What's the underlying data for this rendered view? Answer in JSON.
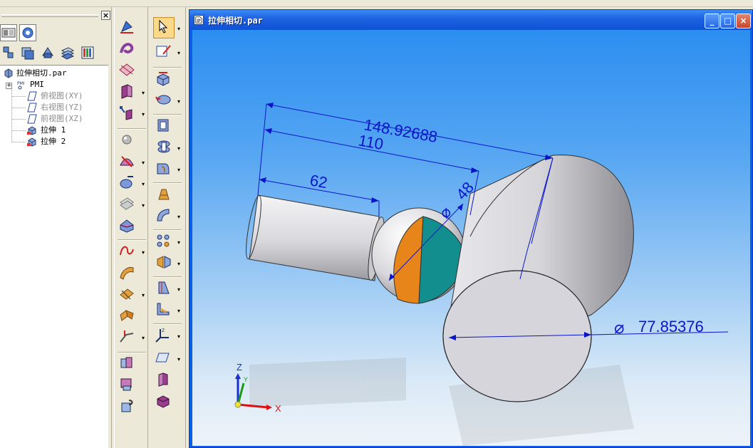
{
  "window": {
    "title": "拉伸相切.par"
  },
  "left_panel": {
    "close_glyph": "×",
    "tree": {
      "root": "拉伸相切.par",
      "items": [
        {
          "label": "PMI",
          "icon": "pmi-icon",
          "greyed": false
        },
        {
          "label": "俯视图(XY)",
          "icon": "plane-icon",
          "greyed": true
        },
        {
          "label": "右视图(YZ)",
          "icon": "plane-icon",
          "greyed": true
        },
        {
          "label": "前视图(XZ)",
          "icon": "plane-icon",
          "greyed": true
        },
        {
          "label": "拉伸 1",
          "icon": "extrude-icon",
          "greyed": false
        },
        {
          "label": "拉伸 2",
          "icon": "extrude-icon",
          "greyed": false
        }
      ]
    }
  },
  "viewport": {
    "dimensions": {
      "d1": "148.92688",
      "d2": "110",
      "d3": "62",
      "d4": "48",
      "d5": "77.85376"
    },
    "diameter_symbol": "⌀",
    "axes": {
      "x": "X",
      "y": "Y",
      "z": "Z"
    },
    "colors": {
      "dimension": "#0b14c9",
      "section_orange": "#e7851a",
      "section_teal": "#138e8e"
    }
  },
  "icons": {
    "title_icon": "part-document-icon",
    "min_glyph": "_",
    "max_glyph": "□",
    "close_glyph": "×"
  }
}
